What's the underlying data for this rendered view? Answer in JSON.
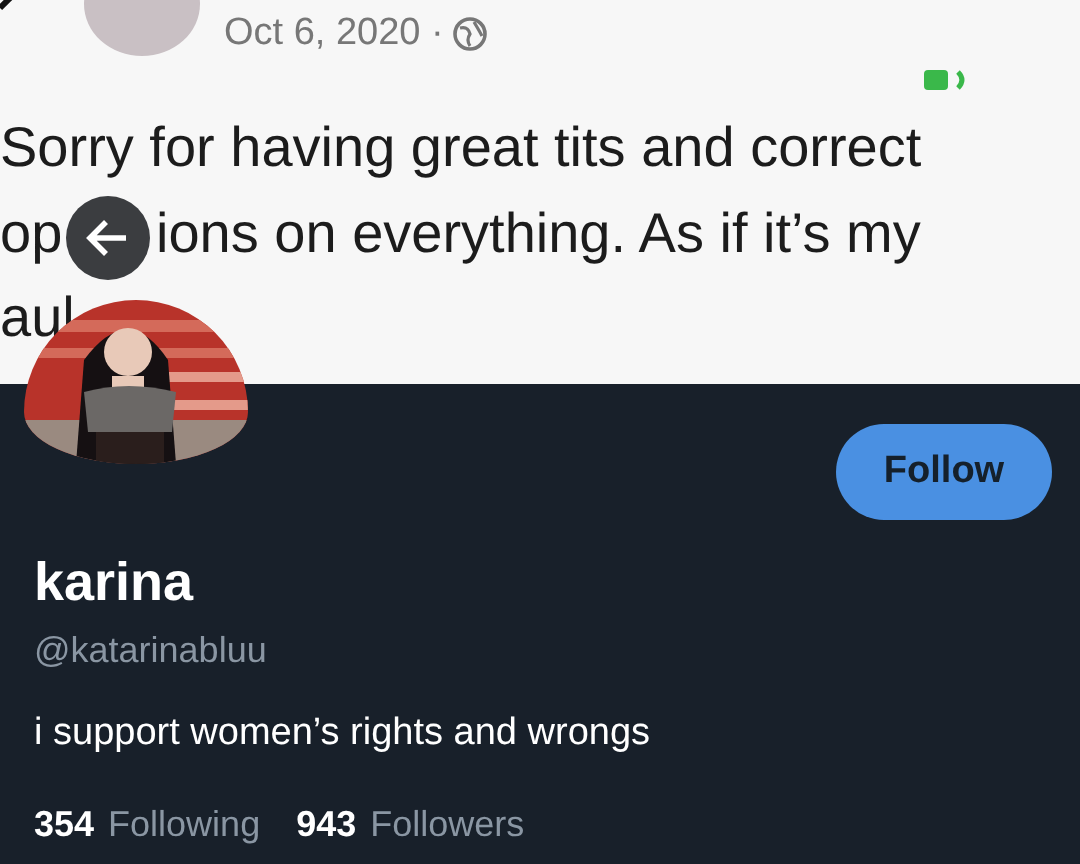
{
  "header_post": {
    "date": "Oct 6, 2020 ·",
    "lines": [
      "Sorry for having great tits and correct",
      "op",
      "ions on everything. As if it’s my",
      "aul"
    ]
  },
  "profile": {
    "follow_button": "Follow",
    "name": "karina",
    "handle": "@katarinabluu",
    "bio": "i support women’s rights and wrongs",
    "stats": [
      {
        "count": "354",
        "label": "Following"
      },
      {
        "count": "943",
        "label": "Followers"
      }
    ]
  }
}
